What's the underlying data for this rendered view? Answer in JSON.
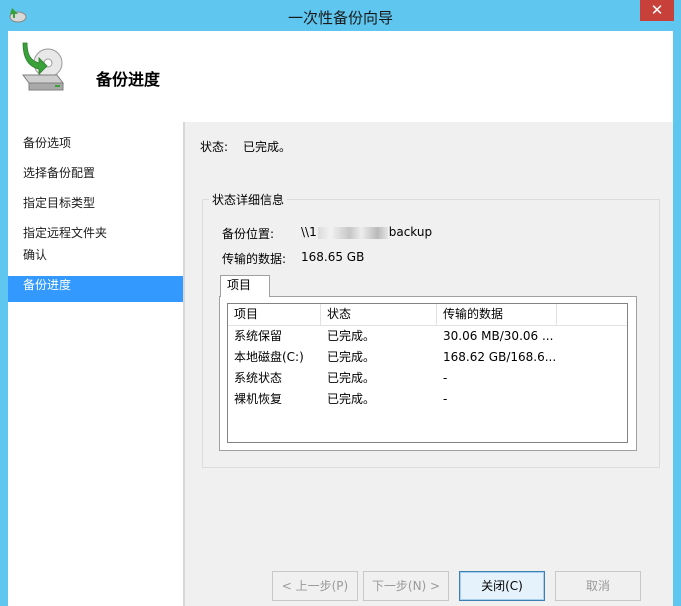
{
  "window": {
    "title": "一次性备份向导",
    "close_glyph": "✕"
  },
  "header": {
    "title": "备份进度",
    "icon": "backup-disk-icon"
  },
  "nav": {
    "items": [
      "备份选项",
      "选择备份配置",
      "指定目标类型",
      "指定远程文件夹",
      "确认",
      "备份进度"
    ]
  },
  "status": {
    "label": "状态:",
    "value": "已完成。"
  },
  "details": {
    "title": "状态详细信息",
    "location_label": "备份位置:",
    "location_prefix": "\\\\1",
    "location_suffix": "backup",
    "transferred_label": "传输的数据:",
    "transferred_value": "168.65 GB"
  },
  "tab": {
    "label": "项目"
  },
  "table": {
    "columns": [
      "项目",
      "状态",
      "传输的数据"
    ],
    "rows": [
      [
        "系统保留",
        "已完成。",
        "30.06 MB/30.06 ..."
      ],
      [
        "本地磁盘(C:)",
        "已完成。",
        "168.62 GB/168.6..."
      ],
      [
        "系统状态",
        "已完成。",
        "-"
      ],
      [
        "裸机恢复",
        "已完成。",
        "-"
      ]
    ]
  },
  "buttons": {
    "prev": "< 上一步(P)",
    "next": "下一步(N) >",
    "close": "关闭(C)",
    "cancel": "取消"
  },
  "colors": {
    "titlebar": "#5fc6ef",
    "nav_selected": "#3399ff",
    "close_button": "#c7403a"
  }
}
